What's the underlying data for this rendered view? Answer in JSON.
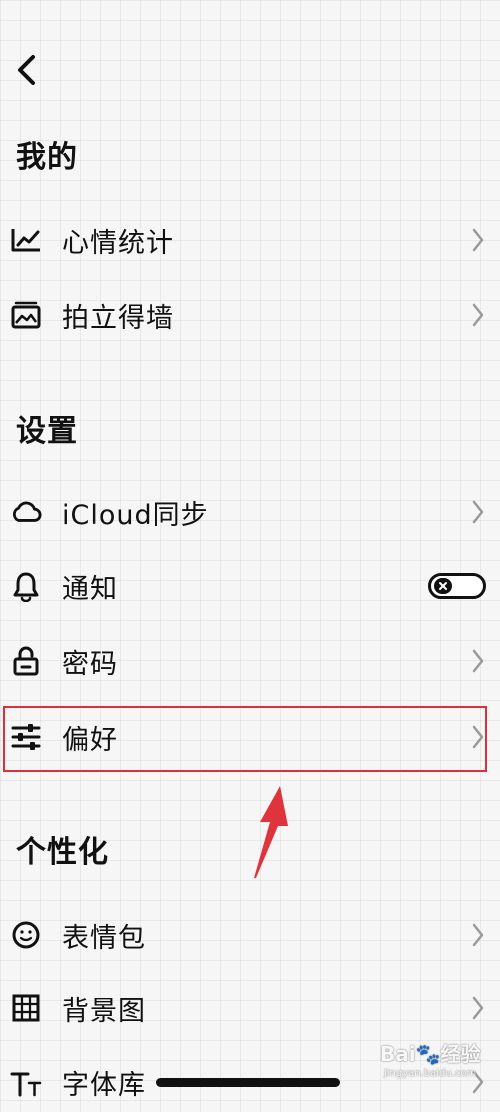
{
  "nav": {
    "back_icon": "chevron-left-icon"
  },
  "sections": {
    "mine": {
      "title": "我的",
      "items": [
        {
          "label": "心情统计",
          "icon": "chart-line-icon",
          "control": "chevron"
        },
        {
          "label": "拍立得墙",
          "icon": "photo-frame-icon",
          "control": "chevron"
        }
      ]
    },
    "settings": {
      "title": "设置",
      "items": [
        {
          "label": "iCloud同步",
          "icon": "cloud-icon",
          "control": "chevron"
        },
        {
          "label": "通知",
          "icon": "bell-icon",
          "control": "toggle",
          "toggle_on": false
        },
        {
          "label": "密码",
          "icon": "lock-icon",
          "control": "chevron"
        },
        {
          "label": "偏好",
          "icon": "sliders-icon",
          "control": "chevron",
          "highlighted": true
        }
      ]
    },
    "personalize": {
      "title": "个性化",
      "items": [
        {
          "label": "表情包",
          "icon": "smiley-icon",
          "control": "chevron"
        },
        {
          "label": "背景图",
          "icon": "grid-icon",
          "control": "chevron"
        },
        {
          "label": "字体库",
          "icon": "font-size-icon",
          "control": "chevron"
        }
      ]
    }
  },
  "annotation": {
    "color": "#d8313a"
  },
  "watermark": {
    "brand": "Bai",
    "brand_suffix": "经验",
    "domain": "jingyan.baidu.com"
  }
}
